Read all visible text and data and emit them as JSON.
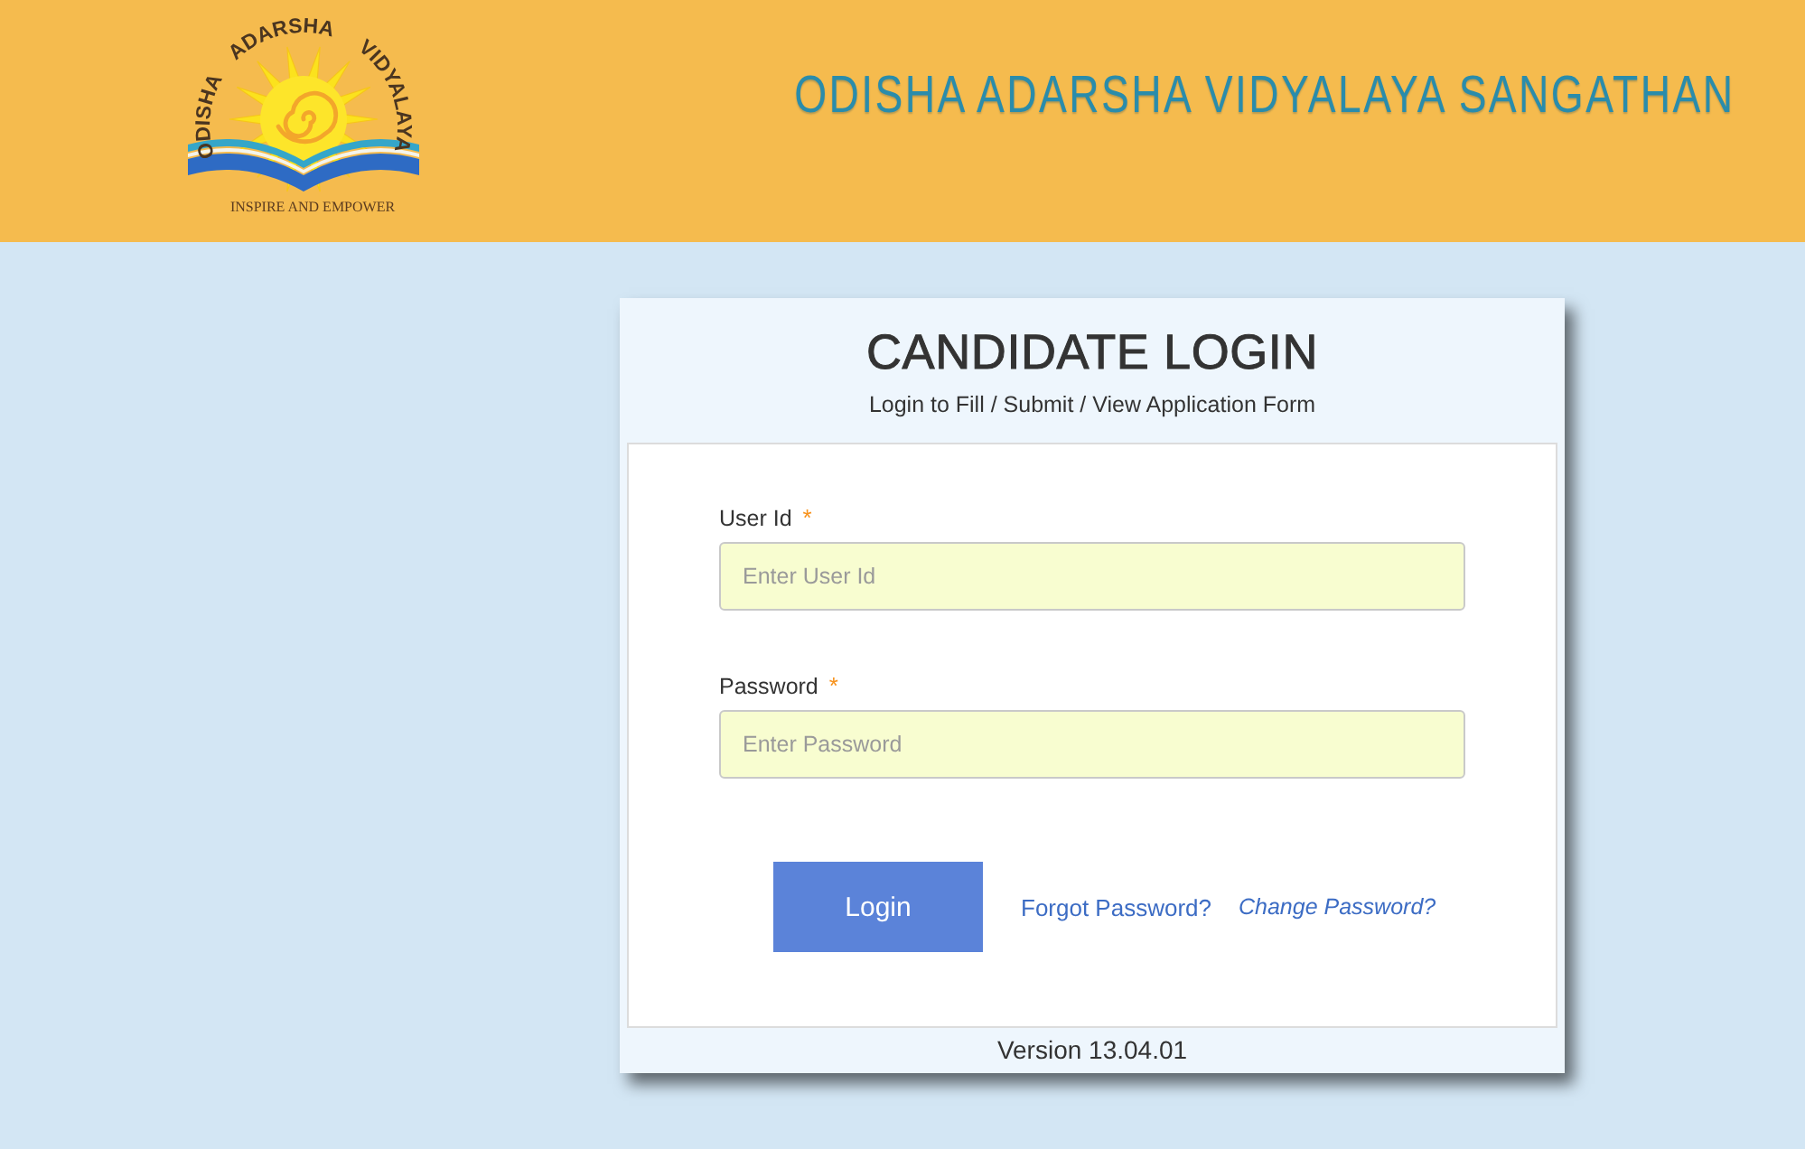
{
  "header": {
    "logo": {
      "arc_text": "ODISHA ADARSHA VIDYALAYA",
      "tagline": "INSPIRE AND EMPOWER"
    },
    "title": "ODISHA ADARSHA VIDYALAYA SANGATHAN"
  },
  "login": {
    "title": "CANDIDATE LOGIN",
    "subtitle": "Login to Fill / Submit / View Application Form",
    "fields": [
      {
        "label": "User Id",
        "required_mark": "*",
        "placeholder": "Enter User Id"
      },
      {
        "label": "Password",
        "required_mark": "*",
        "placeholder": "Enter Password"
      }
    ],
    "submit": "Login",
    "links": [
      {
        "label": "Forgot Password?",
        "italic": false
      },
      {
        "label": "Change Password?",
        "italic": true
      }
    ],
    "version": "Version 13.04.01"
  }
}
